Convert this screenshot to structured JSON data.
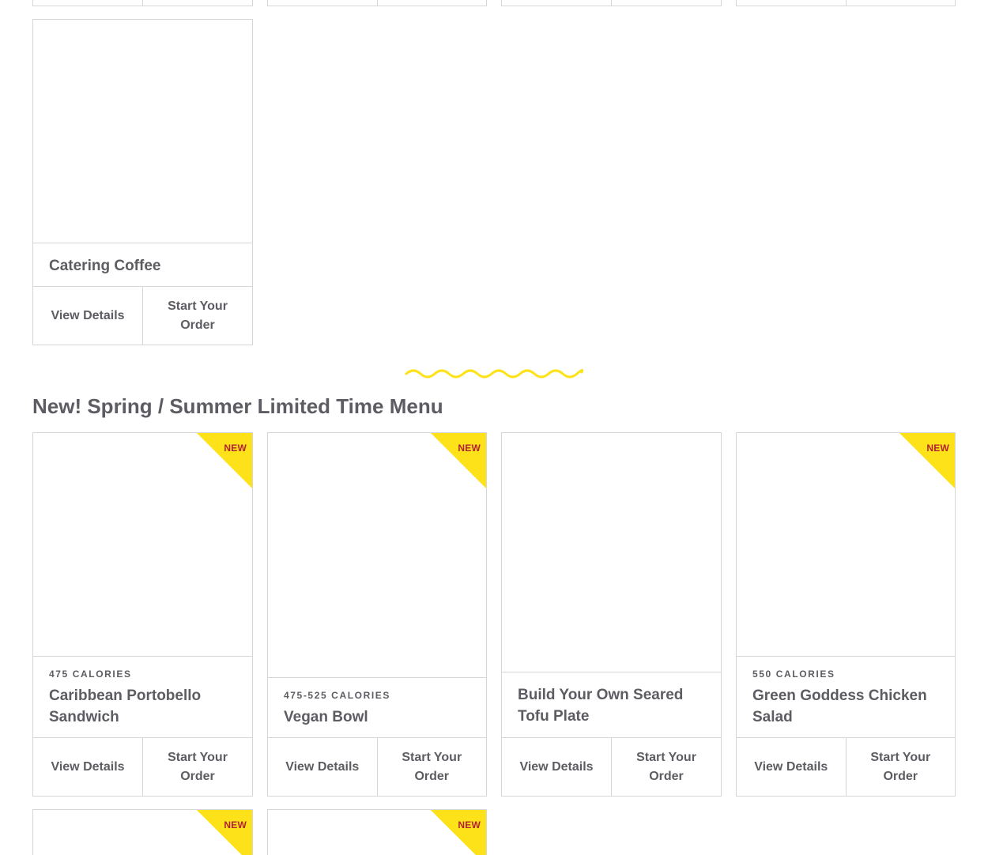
{
  "colors": {
    "text": "#5c5c62",
    "border": "#d6d6d6",
    "badge_yellow": "#fde21a",
    "badge_text": "#b22234",
    "squiggle": "#fde21a"
  },
  "buttons": {
    "view_details": "View Details",
    "start_order": "Start Your Order"
  },
  "catering": {
    "item": {
      "title": "Catering Coffee"
    }
  },
  "spring_menu": {
    "heading": "New! Spring / Summer Limited Time Menu",
    "badge_label": "NEW",
    "items": [
      {
        "calories": "475 CALORIES",
        "title": "Caribbean Portobello Sandwich",
        "is_new": true
      },
      {
        "calories": "475-525 CALORIES",
        "title": "Vegan Bowl",
        "is_new": true
      },
      {
        "calories": "",
        "title": "Build Your Own Seared Tofu Plate",
        "is_new": false
      },
      {
        "calories": "550 CALORIES",
        "title": "Green Goddess Chicken Salad",
        "is_new": true
      }
    ]
  }
}
